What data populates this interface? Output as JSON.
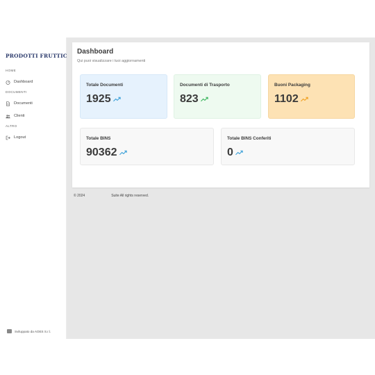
{
  "sidebar": {
    "logo": "PRODOTTI FRUTTICOLI",
    "sections": {
      "home": "HOME",
      "documenti": "DOCUMENTI",
      "altro": "ALTRO"
    },
    "items": [
      {
        "label": "Dashboard",
        "icon": "dashboard-icon"
      },
      {
        "label": "Documenti",
        "icon": "document-icon"
      },
      {
        "label": "Clienti",
        "icon": "users-icon"
      },
      {
        "label": "Logout",
        "icon": "logout-icon"
      }
    ],
    "footer": "Sviluppato da AOES S.r.l."
  },
  "header": {
    "title": "Dashboard",
    "subtitle": "Qui puoi visualizzare i tuoi aggiornamenti"
  },
  "stats": [
    {
      "label": "Totale Documenti",
      "value": "1925",
      "trend_color": "#3aa0d8"
    },
    {
      "label": "Documenti di Trasporto",
      "value": "823",
      "trend_color": "#37b45a"
    },
    {
      "label": "Buoni Packaging",
      "value": "1102",
      "trend_color": "#f0a020"
    },
    {
      "label": "Totale BINS",
      "value": "90362",
      "trend_color": "#3aa0d8"
    },
    {
      "label": "Totale BINS Conferiti",
      "value": "0",
      "trend_color": "#3aa0d8"
    }
  ],
  "footer": {
    "year": "© 2024",
    "rights": "Suite All rights reserved."
  },
  "colors": {
    "card_blue": "#e6f2fd",
    "card_green": "#eefaf0",
    "card_orange": "#fde2b4",
    "card_gray": "#f8f8f8",
    "main_bg": "#e7e7e7",
    "logo": "#2b3a6b"
  }
}
